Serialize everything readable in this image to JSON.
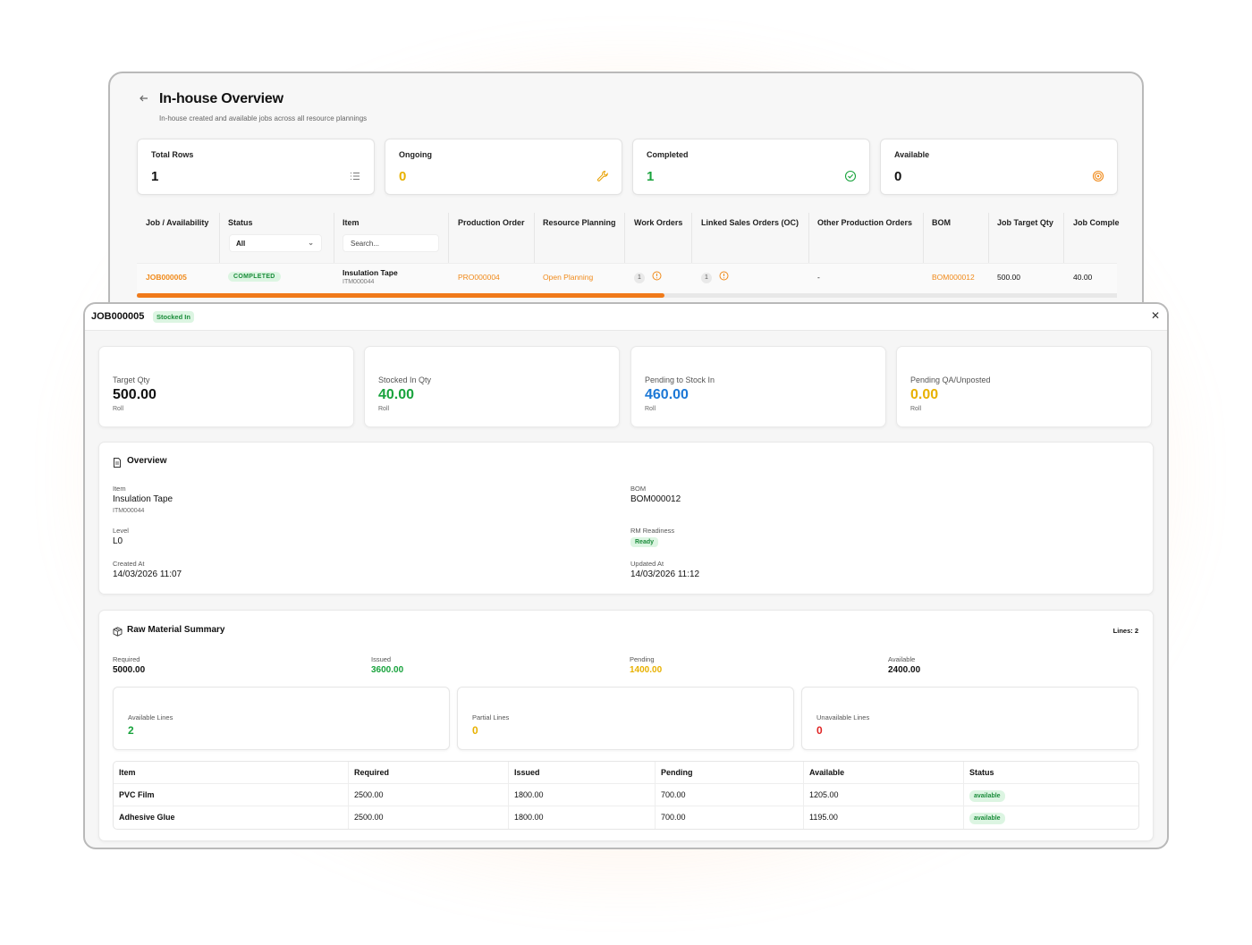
{
  "overview_page": {
    "title": "In-house Overview",
    "subtitle": "In-house created and available jobs across all resource plannings",
    "stats": [
      {
        "label": "Total Rows",
        "value": "1",
        "icon": "list-icon",
        "color": "#111111"
      },
      {
        "label": "Ongoing",
        "value": "0",
        "icon": "wrench-icon",
        "color": "#e8b100"
      },
      {
        "label": "Completed",
        "value": "1",
        "icon": "check-circle-icon",
        "color": "#19a33d"
      },
      {
        "label": "Available",
        "value": "0",
        "icon": "target-icon",
        "color": "#111111"
      }
    ],
    "columns": [
      "Job / Availability",
      "Status",
      "Item",
      "Production Order",
      "Resource Planning",
      "Work Orders",
      "Linked Sales Orders (OC)",
      "Other Production Orders",
      "BOM",
      "Job Target Qty",
      "Job Comple"
    ],
    "status_filter": "All",
    "item_search_placeholder": "Search...",
    "row": {
      "job": "JOB000005",
      "status": "COMPLETED",
      "item_name": "Insulation Tape",
      "item_code": "ITM000044",
      "production_order": "PRO000004",
      "resource_planning": "Open Planning",
      "work_orders": "1",
      "linked_sales_orders": "1",
      "other_production_orders": "-",
      "bom": "BOM000012",
      "job_target_qty": "500.00",
      "job_completed": "40.00"
    }
  },
  "modal": {
    "title": "JOB000005",
    "badge": "Stocked In",
    "qty_cards": [
      {
        "label": "Target Qty",
        "value": "500.00",
        "unit": "Roll",
        "color": "#111111"
      },
      {
        "label": "Stocked In Qty",
        "value": "40.00",
        "unit": "Roll",
        "color": "#19a33d"
      },
      {
        "label": "Pending to Stock In",
        "value": "460.00",
        "unit": "Roll",
        "color": "#1c78d6"
      },
      {
        "label": "Pending QA/Unposted",
        "value": "0.00",
        "unit": "Roll",
        "color": "#e8b100"
      }
    ],
    "overview": {
      "title": "Overview",
      "item_label": "Item",
      "item_name": "Insulation Tape",
      "item_code": "ITM000044",
      "bom_label": "BOM",
      "bom_value": "BOM000012",
      "level_label": "Level",
      "level_value": "L0",
      "rm_label": "RM Readiness",
      "rm_value": "Ready",
      "created_label": "Created At",
      "created_value": "14/03/2026 11:07",
      "updated_label": "Updated At",
      "updated_value": "14/03/2026 11:12"
    },
    "raw_material": {
      "title": "Raw Material Summary",
      "lines_badge": "Lines: 2",
      "totals": [
        {
          "label": "Required",
          "value": "5000.00",
          "color": "#111111"
        },
        {
          "label": "Issued",
          "value": "3600.00",
          "color": "#19a33d"
        },
        {
          "label": "Pending",
          "value": "1400.00",
          "color": "#e8b100"
        },
        {
          "label": "Available",
          "value": "2400.00",
          "color": "#111111"
        }
      ],
      "line_cards": [
        {
          "label": "Available Lines",
          "value": "2",
          "color": "#19a33d"
        },
        {
          "label": "Partial Lines",
          "value": "0",
          "color": "#e8b100"
        },
        {
          "label": "Unavailable Lines",
          "value": "0",
          "color": "#e02424"
        }
      ],
      "columns": [
        "Item",
        "Required",
        "Issued",
        "Pending",
        "Available",
        "Status"
      ],
      "rows": [
        [
          "PVC Film",
          "2500.00",
          "1800.00",
          "700.00",
          "1205.00",
          "available"
        ],
        [
          "Adhesive Glue",
          "2500.00",
          "1800.00",
          "700.00",
          "1195.00",
          "available"
        ]
      ]
    }
  }
}
